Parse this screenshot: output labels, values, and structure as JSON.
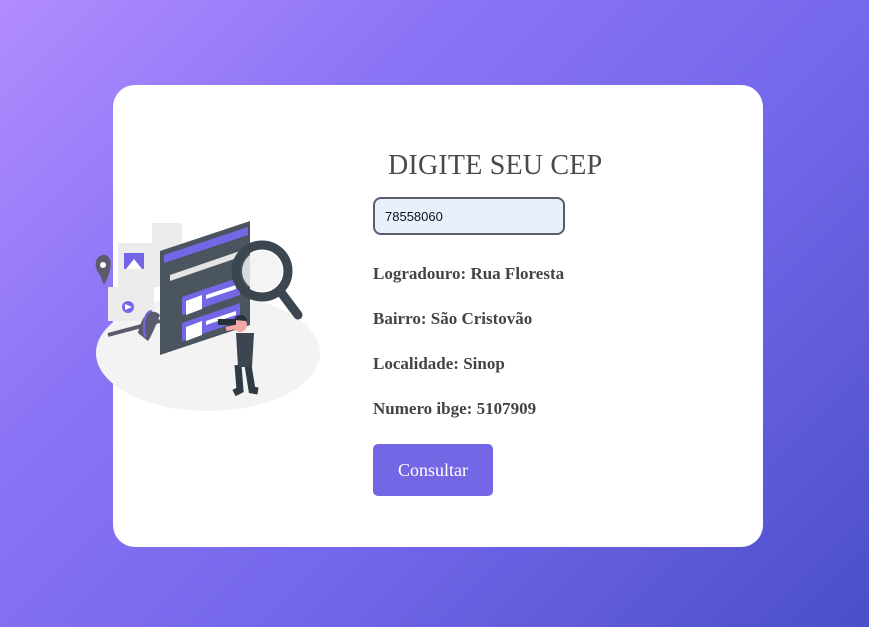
{
  "form": {
    "title": "DIGITE SEU CEP",
    "cep_value": "78558060",
    "button_label": "Consultar"
  },
  "results": {
    "logradouro_label": "Logradouro:",
    "logradouro_value": "Rua Floresta",
    "bairro_label": "Bairro:",
    "bairro_value": "São Cristovão",
    "localidade_label": "Localidade:",
    "localidade_value": "Sinop",
    "ibge_label": "Numero ibge:",
    "ibge_value": "5107909"
  },
  "colors": {
    "accent": "#7467e6",
    "gradient_start": "#b18cff",
    "gradient_end": "#4b4fc8",
    "input_bg": "#e8f0fe"
  },
  "illustration": "person-with-binoculars-searching-web-illustration"
}
